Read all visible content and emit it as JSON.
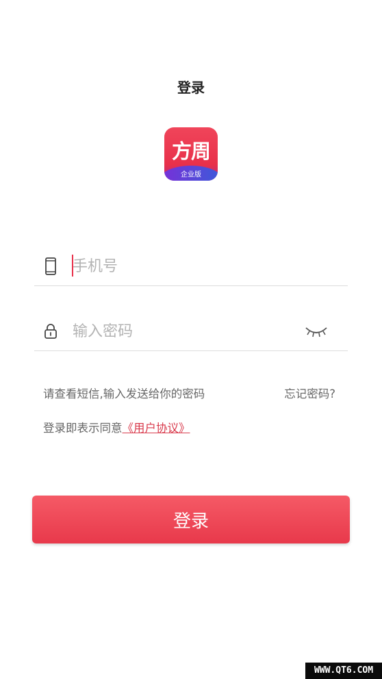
{
  "header": {
    "title": "登录"
  },
  "logo": {
    "main_text": "方周",
    "sub_text": "企业版"
  },
  "phone_field": {
    "placeholder": "手机号",
    "value": "",
    "icon": "phone-icon"
  },
  "password_field": {
    "placeholder": "输入密码",
    "value": "",
    "icon": "lock-icon",
    "toggle_icon": "eye-closed-icon"
  },
  "hint": {
    "text": "请查看短信,输入发送给你的密码"
  },
  "forgot": {
    "label": "忘记密码?"
  },
  "agreement": {
    "prefix": "登录即表示同意",
    "link": "《用户协议》"
  },
  "login_button": {
    "label": "登录"
  },
  "watermark": {
    "text": "WWW.QT6.COM"
  },
  "colors": {
    "accent": "#e8394b",
    "link": "#d93a4c",
    "placeholder": "#b3b3b3",
    "divider": "#dcdcdc"
  }
}
